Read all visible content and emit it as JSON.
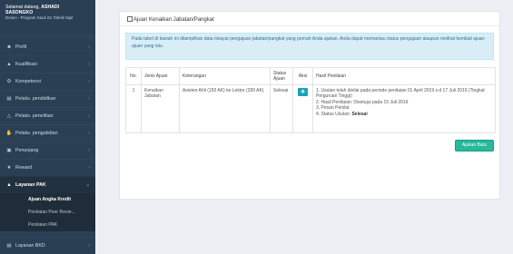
{
  "sidebar": {
    "welcome": "Selamat datang,",
    "name_part1": "ASHADI",
    "name_part2": "SASONGKO",
    "subtitle": "Dosen - Program Studi S1 Teknik Sipil",
    "items": [
      {
        "label": "Profil",
        "icon": "user-icon"
      },
      {
        "label": "Kualifikasi",
        "icon": "graduation-icon"
      },
      {
        "label": "Kompetensi",
        "icon": "gear-icon"
      },
      {
        "label": "Pelaks. pendidikan",
        "icon": "book-icon"
      },
      {
        "label": "Pelaks. penelitian",
        "icon": "flask-icon"
      },
      {
        "label": "Pelaks. pengabdian",
        "icon": "hands-icon"
      },
      {
        "label": "Penunjang",
        "icon": "calendar-icon"
      },
      {
        "label": "Reward",
        "icon": "trophy-icon"
      },
      {
        "label": "Layanan PAK",
        "icon": "graduation-icon"
      }
    ],
    "submenu": [
      "Ajuan Angka Kredit",
      "Penilaian Peer Revie...",
      "Penilaian PAK"
    ],
    "last_item": "Layanan BKD"
  },
  "panel": {
    "title": "Ajuan Kenaikan Jabatan/Pangkat",
    "info": "Pada tabel di bawah ini ditampilkan data riwayat pengajuan jabatan/pangkat yang pernah Anda ajukan. Anda dapat memantau status pengajuan ataupun melihat kembali ajuan-ajuan yang lalu."
  },
  "table": {
    "headers": [
      "No.",
      "Jenis Ajuan",
      "Keterangan",
      "Status Ajuan",
      "Aksi",
      "Hasil Penilaian"
    ],
    "row": {
      "no": "1",
      "jenis": "Kenaikan Jabatan",
      "keterangan": "Asisten Ahli (150 AK) ke Lektor (200 AK)",
      "status": "Selesai",
      "hasil": [
        "1. Usulan telah dinilai pada periode penilaian 01 April 2019 s.d 17 Juli 2019 (Tingkat Perguruan Tinggi)",
        "2. Hasil Penilaian: Disetujui pada 15 Juli 2019",
        "3. Pesan Penilai:",
        "4. Status Usulan: "
      ],
      "status_usulan": "Selesai"
    }
  },
  "buttons": {
    "new": "Ajukan Baru"
  }
}
